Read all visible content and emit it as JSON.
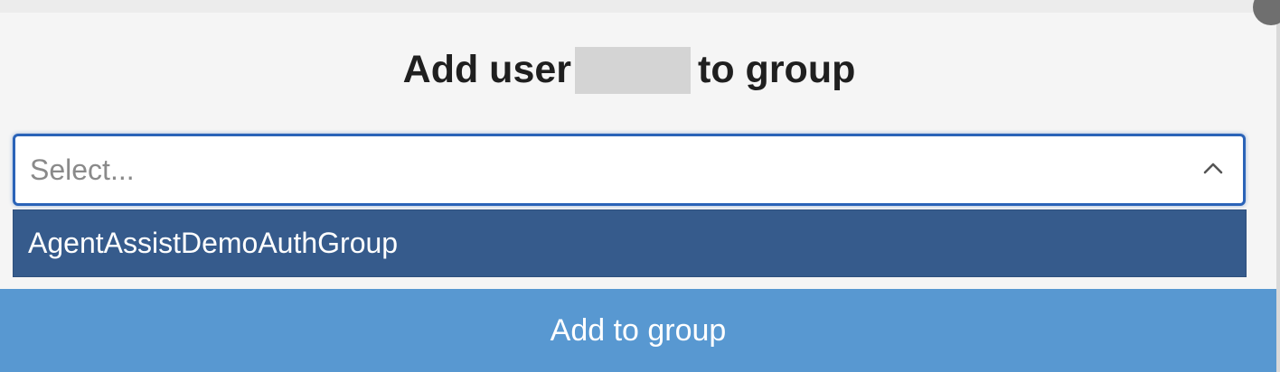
{
  "dialog": {
    "title_prefix": "Add user",
    "title_suffix": "to group"
  },
  "select": {
    "placeholder": "Select...",
    "chevron_icon": "chevron-up-icon",
    "border_color": "#2a63b8"
  },
  "dropdown": {
    "options": [
      {
        "label": "AgentAssistDemoAuthGroup",
        "highlighted": true
      }
    ],
    "highlight_color": "#365b8c"
  },
  "actions": {
    "add_label": "Add to group",
    "button_color": "#5898d1"
  }
}
